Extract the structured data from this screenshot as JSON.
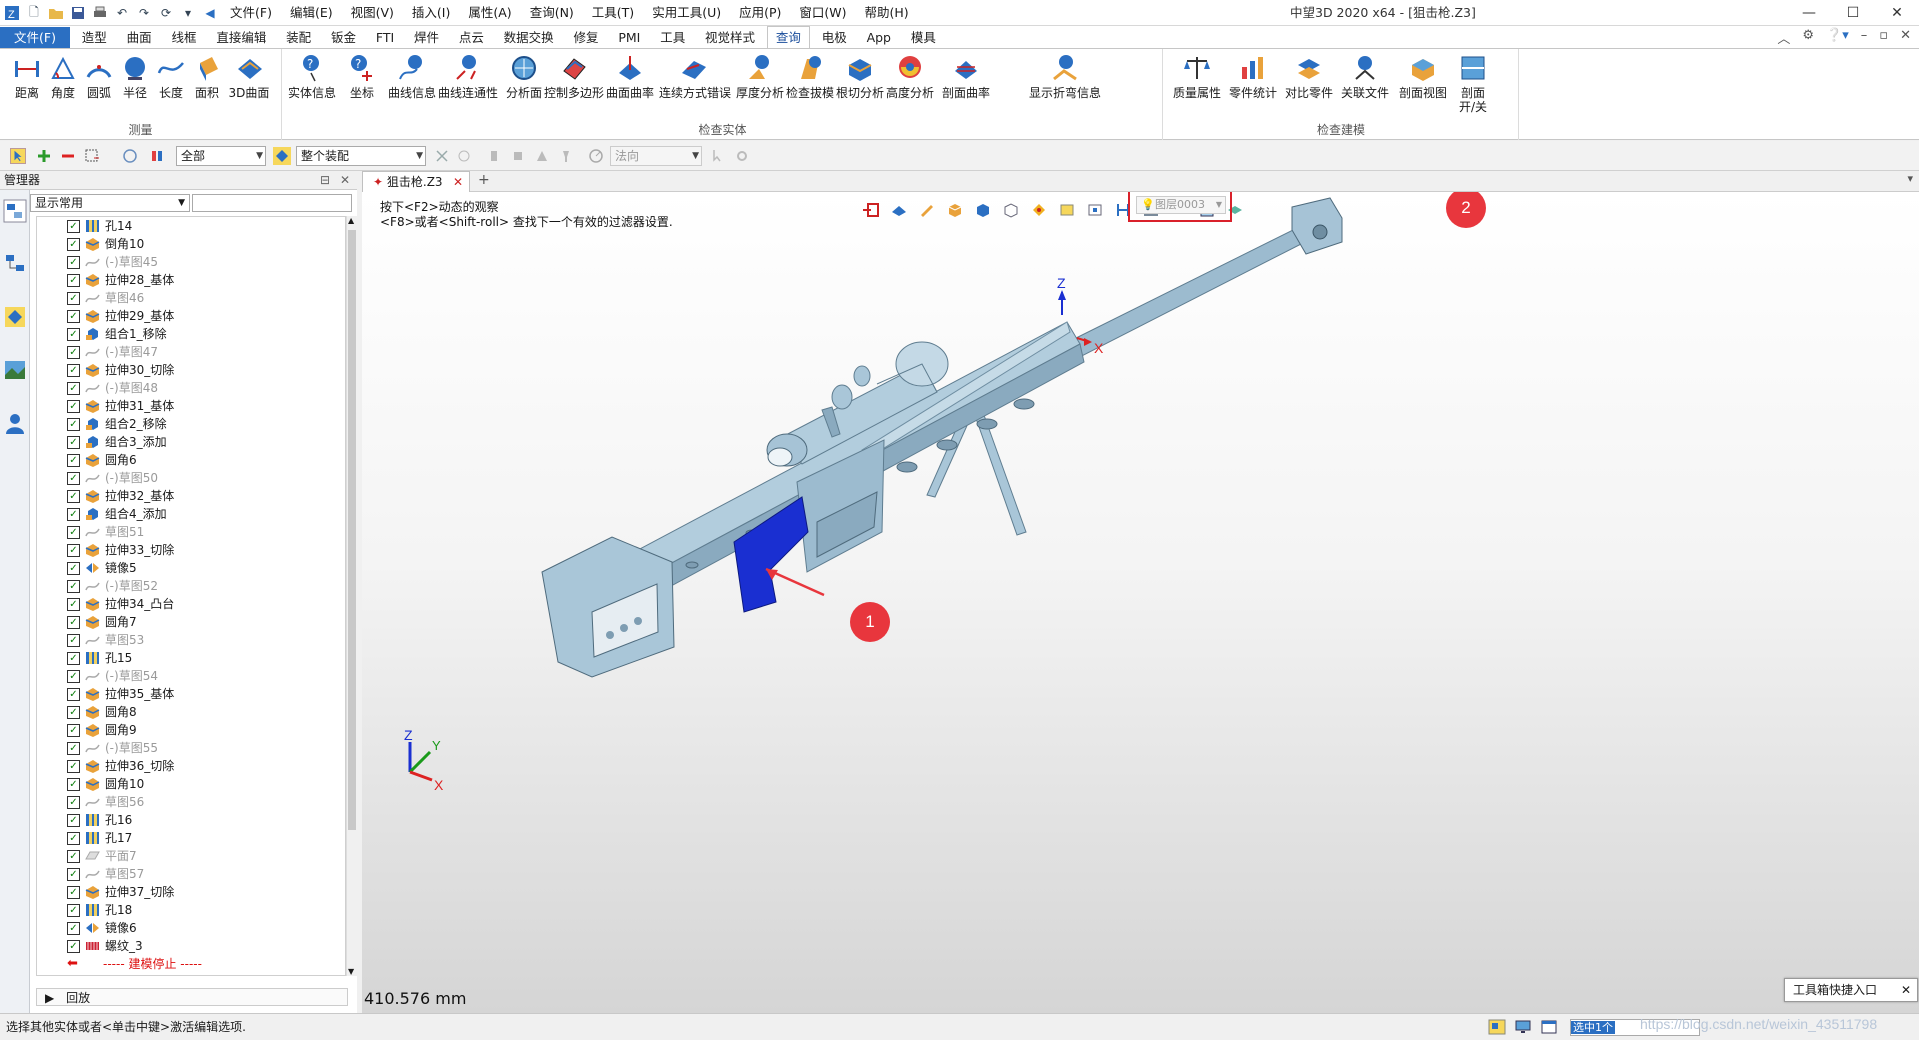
{
  "app": {
    "title": "中望3D 2020 x64 - [狙击枪.Z3]",
    "menus": [
      "文件(F)",
      "编辑(E)",
      "视图(V)",
      "插入(I)",
      "属性(A)",
      "查询(N)",
      "工具(T)",
      "实用工具(U)",
      "应用(P)",
      "窗口(W)",
      "帮助(H)"
    ]
  },
  "ribbon_tabs": {
    "file": "文件(F)",
    "items": [
      "造型",
      "曲面",
      "线框",
      "直接编辑",
      "装配",
      "钣金",
      "FTI",
      "焊件",
      "点云",
      "数据交换",
      "修复",
      "PMI",
      "工具",
      "视觉样式"
    ],
    "active": "查询",
    "rest": [
      "电极",
      "App",
      "模具"
    ]
  },
  "ribbon": {
    "measure_group": {
      "name": "测量",
      "buttons": [
        "距离",
        "角度",
        "圆弧",
        "半径",
        "长度",
        "面积",
        "3D曲面"
      ]
    },
    "check_entity_group": {
      "name": "检查实体",
      "buttons": [
        "实体信息",
        "坐标",
        "曲线信息",
        "曲线连通性",
        "分析面",
        "控制多边形",
        "曲面曲率",
        "连续方式错误",
        "厚度分析",
        "检查拔模",
        "根切分析",
        "高度分析",
        "剖面曲率",
        "显示折弯信息"
      ]
    },
    "check_model_group": {
      "name": "检查建模",
      "buttons": [
        "质量属性",
        "零件统计",
        "对比零件",
        "关联文件",
        "剖面视图",
        "剖面 开/关"
      ]
    }
  },
  "toolbar2": {
    "filter_value": "全部",
    "assembly_value": "整个装配",
    "direction_placeholder": "法向"
  },
  "manager": {
    "title": "管理器",
    "display_combo": "显示常用",
    "tree": [
      {
        "label": "孔14",
        "type": "hole",
        "gray": false
      },
      {
        "label": "倒角10",
        "type": "feature",
        "gray": false
      },
      {
        "label": "(-)草图45",
        "type": "sketch",
        "gray": true
      },
      {
        "label": "拉伸28_基体",
        "type": "feature",
        "gray": false
      },
      {
        "label": "草图46",
        "type": "sketch",
        "gray": true
      },
      {
        "label": "拉伸29_基体",
        "type": "feature",
        "gray": false
      },
      {
        "label": "组合1_移除",
        "type": "combine",
        "gray": false
      },
      {
        "label": "(-)草图47",
        "type": "sketch",
        "gray": true
      },
      {
        "label": "拉伸30_切除",
        "type": "feature",
        "gray": false
      },
      {
        "label": "(-)草图48",
        "type": "sketch",
        "gray": true
      },
      {
        "label": "拉伸31_基体",
        "type": "feature",
        "gray": false
      },
      {
        "label": "组合2_移除",
        "type": "combine",
        "gray": false
      },
      {
        "label": "组合3_添加",
        "type": "combine",
        "gray": false
      },
      {
        "label": "圆角6",
        "type": "feature",
        "gray": false
      },
      {
        "label": "(-)草图50",
        "type": "sketch",
        "gray": true
      },
      {
        "label": "拉伸32_基体",
        "type": "feature",
        "gray": false
      },
      {
        "label": "组合4_添加",
        "type": "combine",
        "gray": false
      },
      {
        "label": "草图51",
        "type": "sketch",
        "gray": true
      },
      {
        "label": "拉伸33_切除",
        "type": "feature",
        "gray": false
      },
      {
        "label": "镜像5",
        "type": "mirror",
        "gray": false
      },
      {
        "label": "(-)草图52",
        "type": "sketch",
        "gray": true
      },
      {
        "label": "拉伸34_凸台",
        "type": "feature",
        "gray": false
      },
      {
        "label": "圆角7",
        "type": "feature",
        "gray": false
      },
      {
        "label": "草图53",
        "type": "sketch",
        "gray": true
      },
      {
        "label": "孔15",
        "type": "hole",
        "gray": false
      },
      {
        "label": "(-)草图54",
        "type": "sketch",
        "gray": true
      },
      {
        "label": "拉伸35_基体",
        "type": "feature",
        "gray": false
      },
      {
        "label": "圆角8",
        "type": "feature",
        "gray": false
      },
      {
        "label": "圆角9",
        "type": "feature",
        "gray": false
      },
      {
        "label": "(-)草图55",
        "type": "sketch",
        "gray": true
      },
      {
        "label": "拉伸36_切除",
        "type": "feature",
        "gray": false
      },
      {
        "label": "圆角10",
        "type": "feature",
        "gray": false
      },
      {
        "label": "草图56",
        "type": "sketch",
        "gray": true
      },
      {
        "label": "孔16",
        "type": "hole",
        "gray": false
      },
      {
        "label": "孔17",
        "type": "hole",
        "gray": false
      },
      {
        "label": "平面7",
        "type": "plane",
        "gray": true
      },
      {
        "label": "草图57",
        "type": "sketch",
        "gray": true
      },
      {
        "label": "拉伸37_切除",
        "type": "feature",
        "gray": false
      },
      {
        "label": "孔18",
        "type": "hole",
        "gray": false
      },
      {
        "label": "镜像6",
        "type": "mirror",
        "gray": false
      },
      {
        "label": "螺纹_3",
        "type": "thread",
        "gray": false
      }
    ],
    "stop_label": "----- 建模停止 -----",
    "rollback": "回放"
  },
  "document": {
    "tab": "狙击枪.Z3",
    "hint_line1": "按下<F2>动态的观察",
    "hint_line2": "<F8>或者<Shift-roll> 查找下一个有效的过滤器设置.",
    "layer_combo": "图层0003",
    "measure_text": "410.576 mm",
    "tool_entry": "工具箱快捷入口",
    "markers": [
      "1",
      "2"
    ],
    "axis_labels": {
      "x": "X",
      "y": "Y",
      "z": "Z"
    }
  },
  "status": {
    "message": "选择其他实体或者<单击中键>激活编辑选项.",
    "selected": "选中1个",
    "watermark": "https://blog.csdn.net/weixin_43511798"
  },
  "colors": {
    "accent": "#2b6fc2",
    "model": "#a9c6d8",
    "highlight": "#1a2fd1",
    "marker": "#e8363d"
  }
}
